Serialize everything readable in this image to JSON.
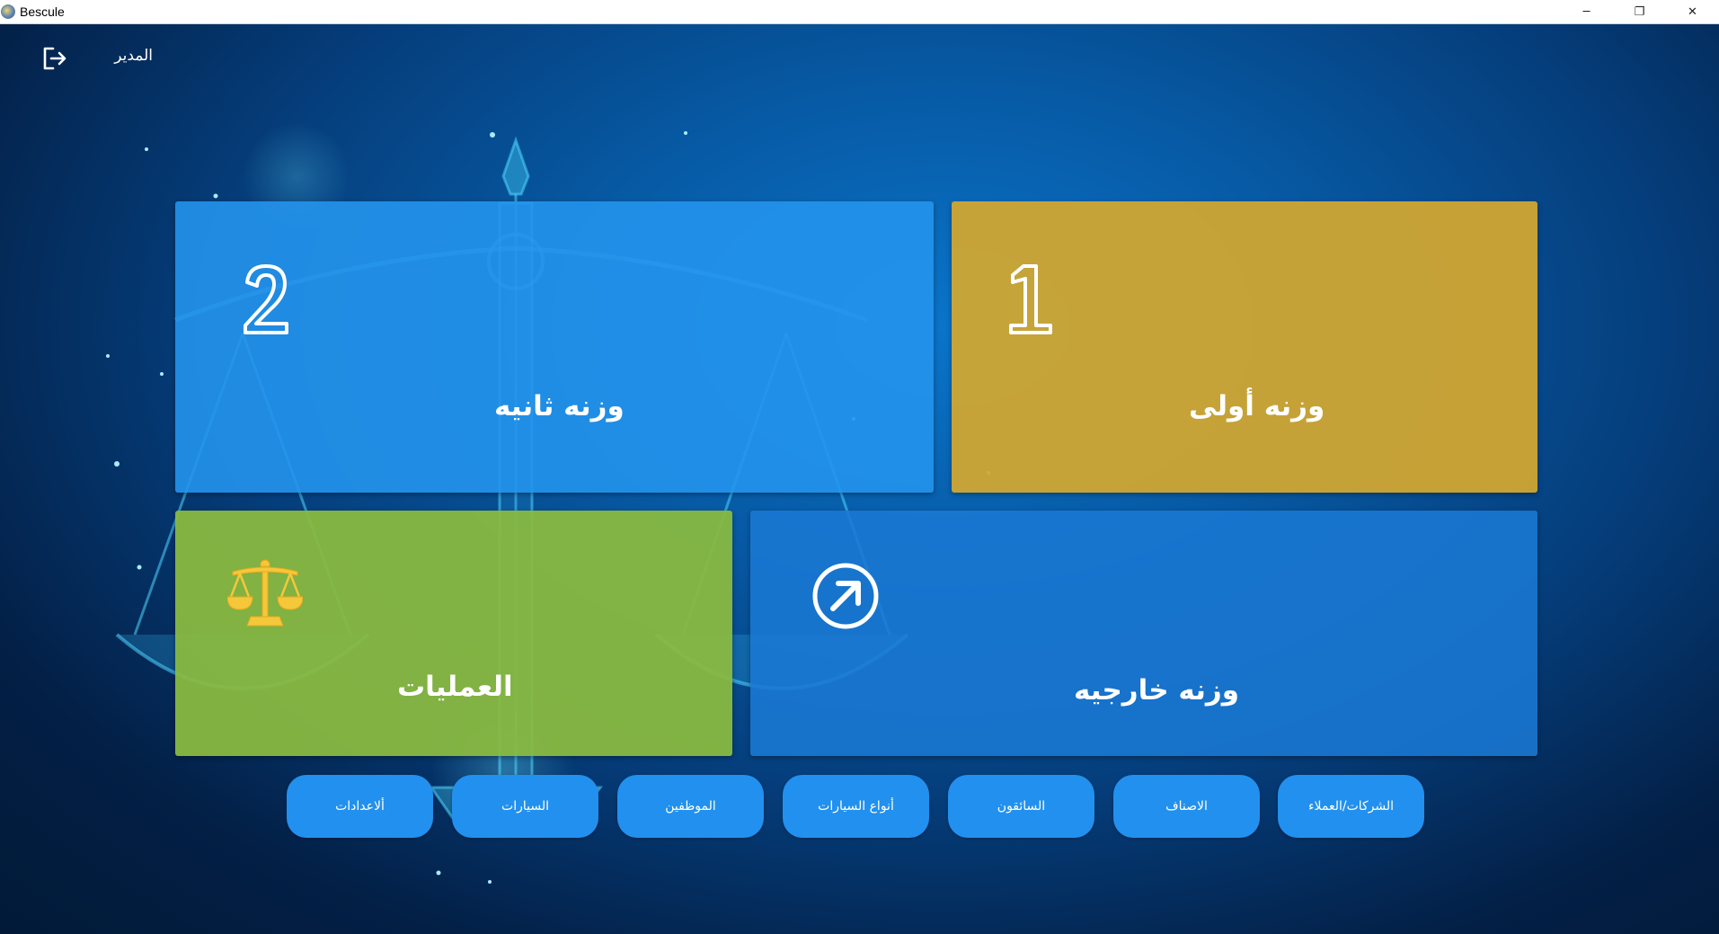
{
  "window": {
    "title": "Bescule",
    "minimize_glyph": "─",
    "restore_glyph": "❐",
    "close_glyph": "✕"
  },
  "header": {
    "user_label": "المدير",
    "logout_icon": "logout-icon"
  },
  "tiles": {
    "weight1": {
      "label": "وزنه أولى",
      "icon": "number-1-icon",
      "color": "#d4a82f"
    },
    "weight2": {
      "label": "وزنه ثانيه",
      "icon": "number-2-icon",
      "color": "#2494ec"
    },
    "operations": {
      "label": "العمليات",
      "icon": "scales-icon",
      "color": "#89ba40"
    },
    "external": {
      "label": "وزنه خارجيه",
      "icon": "arrow-up-right-circle-icon",
      "color": "#1a79d4"
    }
  },
  "bottom_buttons": [
    {
      "label": "الشركات/العملاء"
    },
    {
      "label": "الاصناف"
    },
    {
      "label": "السائقون"
    },
    {
      "label": "أنواع السيارات"
    },
    {
      "label": "الموظفين"
    },
    {
      "label": "السيارات"
    },
    {
      "label": "ألاعدادات"
    }
  ],
  "colors": {
    "accent_button": "#2290ee",
    "background_dark": "#021a38",
    "background_light": "#0a74c9"
  }
}
